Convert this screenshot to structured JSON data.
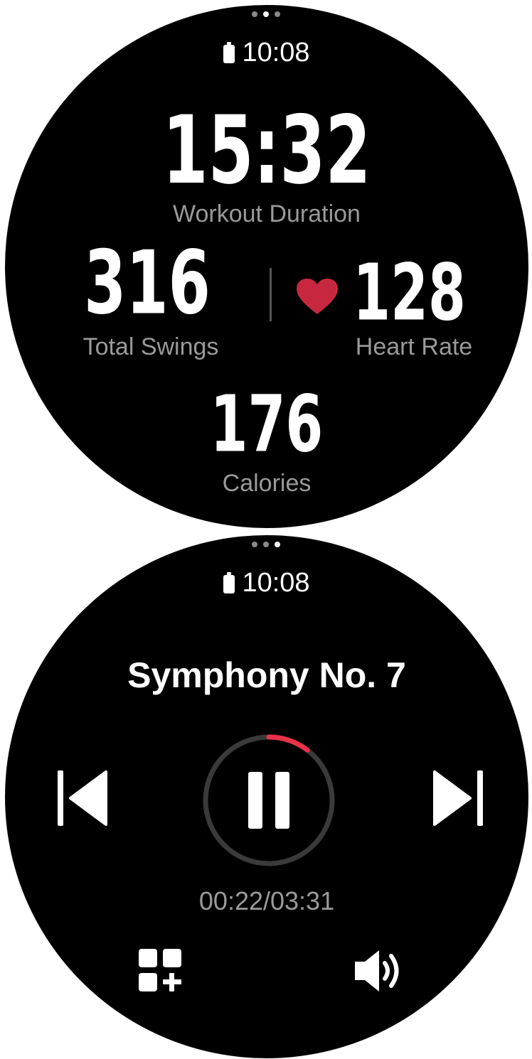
{
  "workout_screen": {
    "pager_dots": [
      false,
      true,
      false
    ],
    "status_time": "10:08",
    "duration": {
      "value": "15:32",
      "label": "Workout Duration"
    },
    "swings": {
      "value": "316",
      "label": "Total Swings"
    },
    "heart_rate": {
      "value": "128",
      "label": "Heart Rate",
      "icon": "heart-icon",
      "icon_color": "#c8283f"
    },
    "calories": {
      "value": "176",
      "label": "Calories"
    }
  },
  "music_screen": {
    "pager_dots": [
      false,
      false,
      true
    ],
    "status_time": "10:08",
    "track_title": "Symphony No. 7",
    "progress": {
      "elapsed": "00:22",
      "total": "03:31",
      "readout": "00:22/03:31",
      "fraction": 0.104
    },
    "controls": {
      "previous": "previous-track-icon",
      "play_pause": "pause-icon",
      "next": "next-track-icon",
      "add_to_playlist": "add-widget-icon",
      "volume": "volume-icon"
    },
    "accent_color": "#e8324a",
    "ring_color": "#3a3a3a"
  }
}
